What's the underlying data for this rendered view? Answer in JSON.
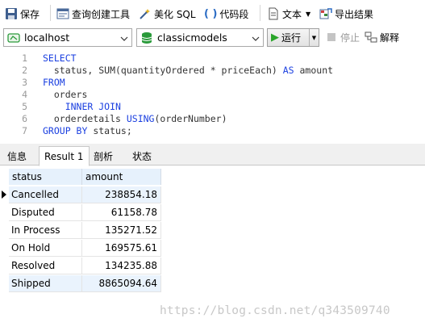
{
  "toolbar": {
    "save": "保存",
    "query_builder": "查询创建工具",
    "beautify_sql": "美化 SQL",
    "code_snippet": "代码段",
    "text": "文本",
    "export_results": "导出结果"
  },
  "connection": {
    "server": "localhost",
    "database": "classicmodels",
    "run": "运行",
    "stop": "停止",
    "explain": "解释"
  },
  "editor": {
    "line_numbers": [
      "1",
      "2",
      "3",
      "4",
      "5",
      "6",
      "7"
    ],
    "lines": [
      [
        {
          "t": "SELECT",
          "k": true
        }
      ],
      [
        {
          "t": "  status, SUM(quantityOrdered * priceEach) ",
          "k": false
        },
        {
          "t": "AS",
          "k": true
        },
        {
          "t": " amount",
          "k": false
        }
      ],
      [
        {
          "t": "FROM",
          "k": true
        }
      ],
      [
        {
          "t": "  orders",
          "k": false
        }
      ],
      [
        {
          "t": "    ",
          "k": false
        },
        {
          "t": "INNER JOIN",
          "k": true
        }
      ],
      [
        {
          "t": "  orderdetails ",
          "k": false
        },
        {
          "t": "USING",
          "k": true
        },
        {
          "t": "(orderNumber)",
          "k": false
        }
      ],
      [
        {
          "t": "GROUP BY",
          "k": true
        },
        {
          "t": " status;",
          "k": false
        }
      ]
    ]
  },
  "tabs": [
    "信息",
    "Result 1",
    "剖析",
    "状态"
  ],
  "active_tab": "Result 1",
  "results": {
    "columns": [
      "status",
      "amount"
    ],
    "rows": [
      [
        "Cancelled",
        "238854.18"
      ],
      [
        "Disputed",
        "61158.78"
      ],
      [
        "In Process",
        "135271.52"
      ],
      [
        "On Hold",
        "169575.61"
      ],
      [
        "Resolved",
        "134235.88"
      ],
      [
        "Shipped",
        "8865094.64"
      ]
    ]
  },
  "watermark": "https://blog.csdn.net/q343509740",
  "colors": {
    "keyword": "#1a3fe0",
    "header_bg": "#e6f1fc",
    "run_icon": "#2aa52a",
    "db_icon": "#2a9a3a"
  }
}
